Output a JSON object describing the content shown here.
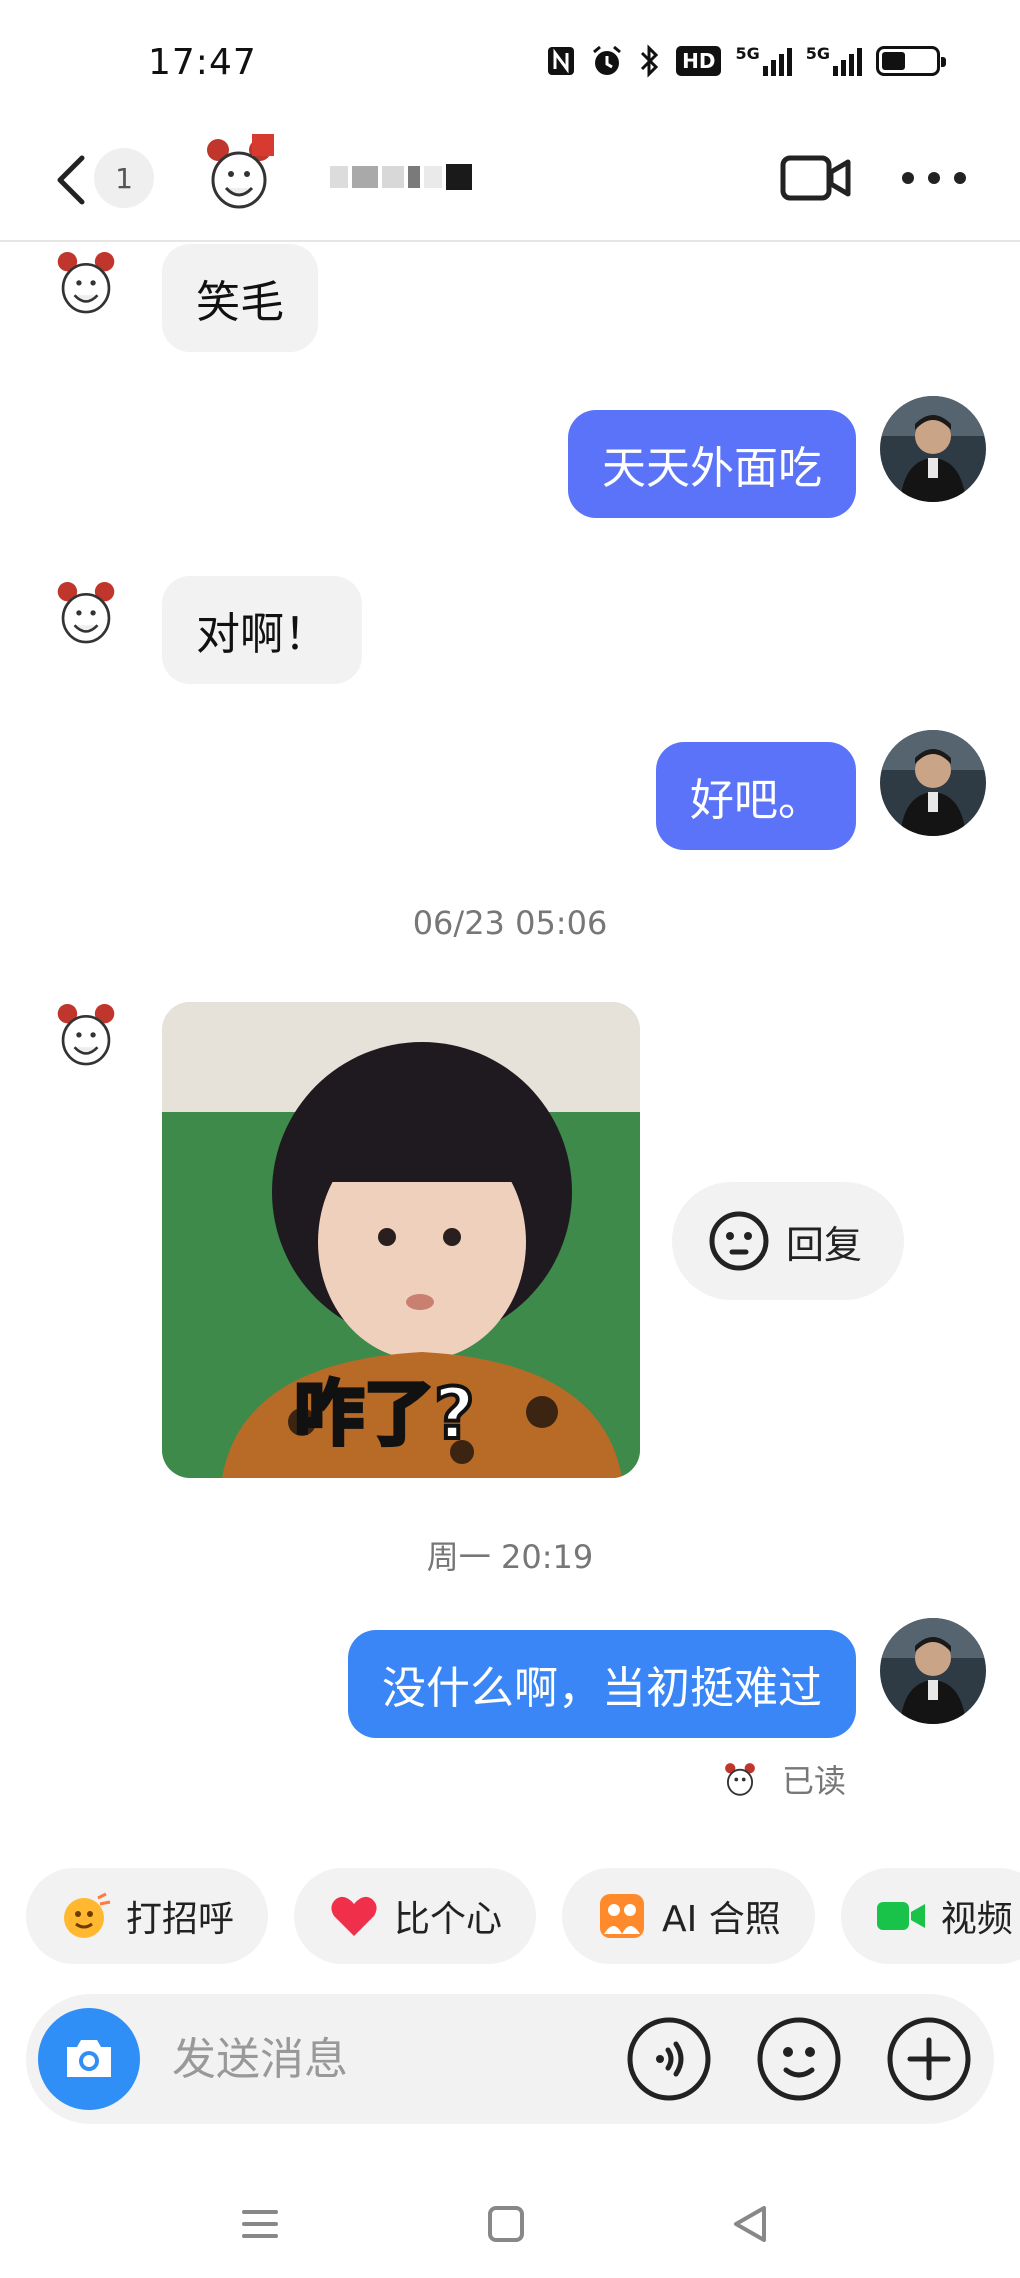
{
  "status_bar": {
    "time": "17:47",
    "icons": [
      "nfc-icon",
      "alarm-icon",
      "bluetooth-icon",
      "hd-icon",
      "signal-5g-icon",
      "signal-5g-icon",
      "battery-icon"
    ],
    "hd_label": "HD",
    "net1": "5G",
    "net2": "5G",
    "battery_level": 0.45
  },
  "header": {
    "unread_count": "1",
    "contact_name": "",
    "video_call": "video-camera-icon",
    "more": "more-icon"
  },
  "messages": [
    {
      "side": "in",
      "text": "笑毛"
    },
    {
      "side": "out",
      "text": "天天外面吃"
    },
    {
      "side": "in",
      "text": "对啊！"
    },
    {
      "side": "out",
      "text": "好吧。"
    }
  ],
  "timestamp_1": "06/23 05:06",
  "sticker": {
    "caption": "咋了?"
  },
  "reply": {
    "label": "回复"
  },
  "timestamp_2": "周一 20:19",
  "last_message": "没什么啊，当初挺难过",
  "read_status": "已读",
  "quick_actions": [
    {
      "label": "打招呼",
      "icon": "wave-emoji-icon"
    },
    {
      "label": "比个心",
      "icon": "heart-icon"
    },
    {
      "label": "AI 合照",
      "icon": "ai-photo-icon"
    },
    {
      "label": "视频",
      "icon": "video-icon"
    }
  ],
  "input": {
    "placeholder": "发送消息"
  },
  "colors": {
    "bubble_out": "#5b73f8",
    "bubble_out_last": "#3a86f7",
    "bubble_in": "#f2f2f2",
    "camera": "#2f8ff6"
  }
}
